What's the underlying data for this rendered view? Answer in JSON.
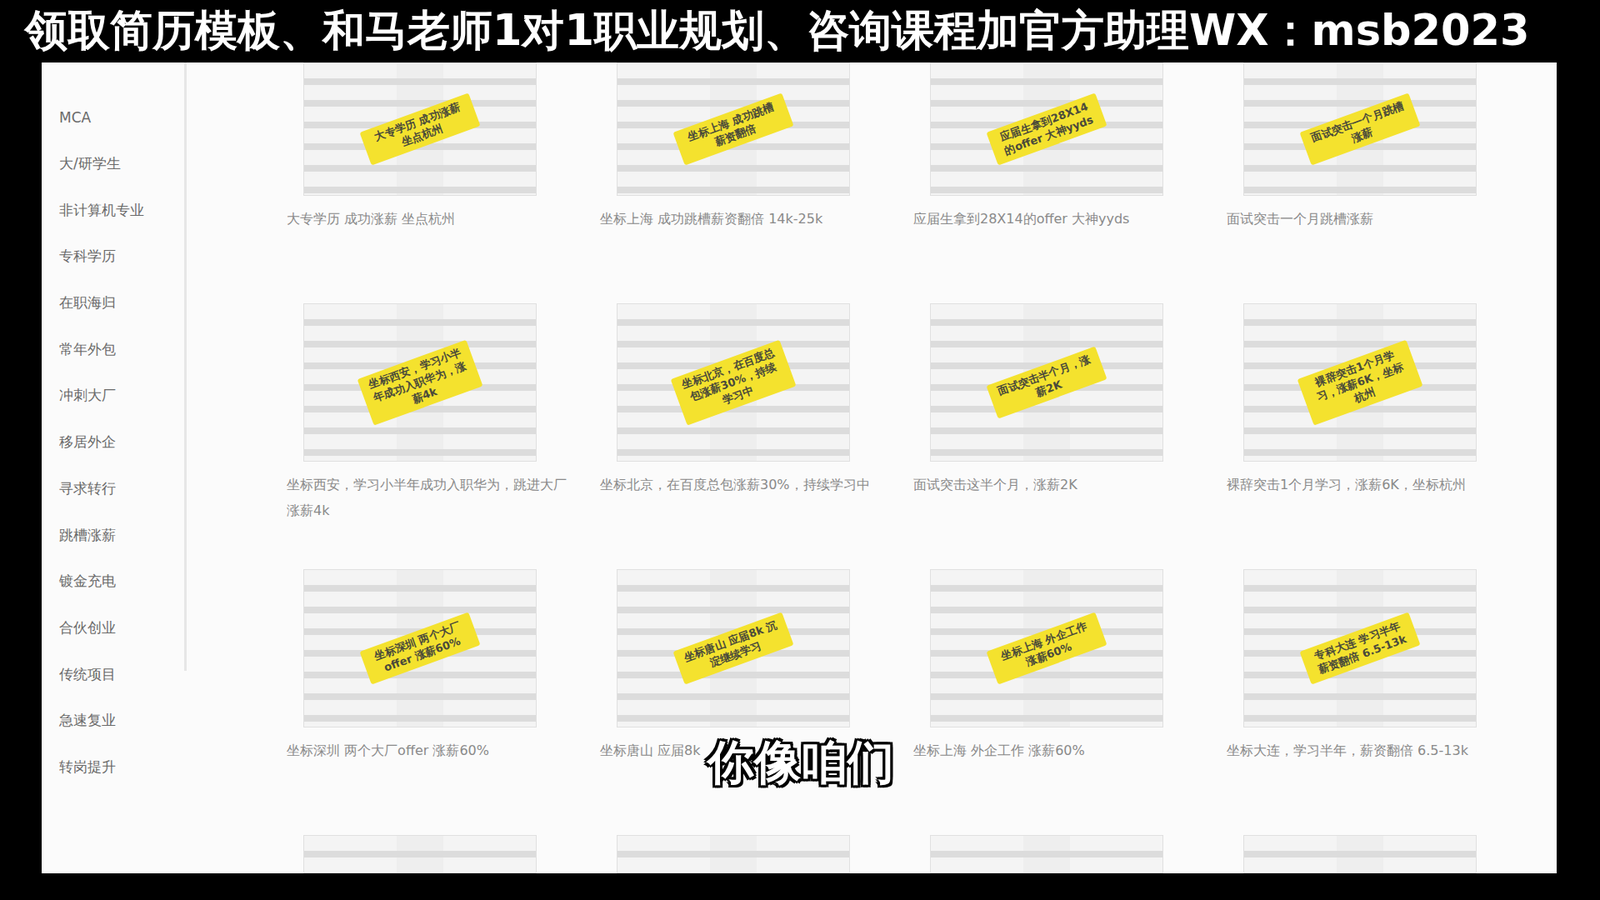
{
  "banner": {
    "text": "领取简历模板、和马老师1对1职业规划、咨询课程加官方助理WX：msb2023"
  },
  "sidebar": {
    "items": [
      {
        "label": "MCA"
      },
      {
        "label": "大/研学生"
      },
      {
        "label": "非计算机专业"
      },
      {
        "label": "专科学历"
      },
      {
        "label": "在职海归"
      },
      {
        "label": "常年外包"
      },
      {
        "label": "冲刺大厂"
      },
      {
        "label": "移居外企"
      },
      {
        "label": "寻求转行"
      },
      {
        "label": "跳槽涨薪"
      },
      {
        "label": "镀金充电"
      },
      {
        "label": "合伙创业"
      },
      {
        "label": "传统项目"
      },
      {
        "label": "急速复业"
      },
      {
        "label": "转岗提升"
      }
    ]
  },
  "cards": [
    {
      "kind": "full",
      "tag": "大专学历 成功涨薪 坐点杭州",
      "caption": "大专学历 成功涨薪 坐点杭州"
    },
    {
      "kind": "full",
      "tag": "坐标上海 成功跳槽薪资翻倍",
      "caption": "坐标上海 成功跳槽薪资翻倍 14k-25k"
    },
    {
      "kind": "full",
      "tag": "应届生拿到28X14的offer 大神yyds",
      "caption": "应届生拿到28X14的offer 大神yyds"
    },
    {
      "kind": "full",
      "tag": "面试突击一个月跳槽涨薪",
      "caption": "面试突击一个月跳槽涨薪"
    },
    {
      "kind": "full",
      "tag": "坐标西安，学习小半年成功入职华为，涨薪4k",
      "caption": "坐标西安，学习小半年成功入职华为，跳进大厂涨薪4k"
    },
    {
      "kind": "full",
      "tag": "坐标北京，在百度总包涨薪30%，持续学习中",
      "caption": "坐标北京，在百度总包涨薪30%，持续学习中"
    },
    {
      "kind": "full",
      "tag": "面试突击半个月，涨薪2K",
      "caption": "面试突击这半个月，涨薪2K"
    },
    {
      "kind": "full",
      "tag": "裸辞突击1个月学习，涨薪6K，坐标杭州",
      "caption": "裸辞突击1个月学习，涨薪6K，坐标杭州"
    },
    {
      "kind": "full",
      "tag": "坐标深圳 两个大厂offer 涨薪60%",
      "caption": "坐标深圳 两个大厂offer 涨薪60%"
    },
    {
      "kind": "full",
      "tag": "坐标唐山 应届8k 沉淀继续学习",
      "caption": "坐标唐山 应届8k"
    },
    {
      "kind": "full",
      "tag": "坐标上海 外企工作 涨薪60%",
      "caption": "坐标上海 外企工作 涨薪60%"
    },
    {
      "kind": "full",
      "tag": "专科大连 学习半年 薪资翻倍 6.5-13k",
      "caption": "坐标大连，学习半年，薪资翻倍 6.5-13k"
    },
    {
      "kind": "partial"
    },
    {
      "kind": "partial"
    },
    {
      "kind": "partial"
    },
    {
      "kind": "partial"
    }
  ],
  "subtitle": {
    "text": "你像咱们"
  }
}
